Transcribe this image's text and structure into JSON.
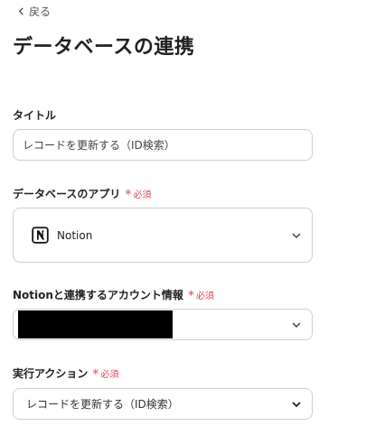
{
  "nav": {
    "back_label": "戻る"
  },
  "page": {
    "title": "データベースの連携"
  },
  "form": {
    "title_field": {
      "label": "タイトル",
      "value": "レコードを更新する（ID検索）"
    },
    "app_field": {
      "label": "データベースのアプリ",
      "required_label": "必須",
      "selected_app": "Notion",
      "app_icon": "notion-icon"
    },
    "account_field": {
      "label": "Notionと連携するアカウント情報",
      "required_label": "必須",
      "value": "[redacted]"
    },
    "action_field": {
      "label": "実行アクション",
      "required_label": "必須",
      "selected_value": "レコードを更新する（ID検索）"
    }
  },
  "colors": {
    "required": "#e0455a",
    "border": "#cfcfcf",
    "text": "#222222",
    "redaction": "#000000"
  }
}
